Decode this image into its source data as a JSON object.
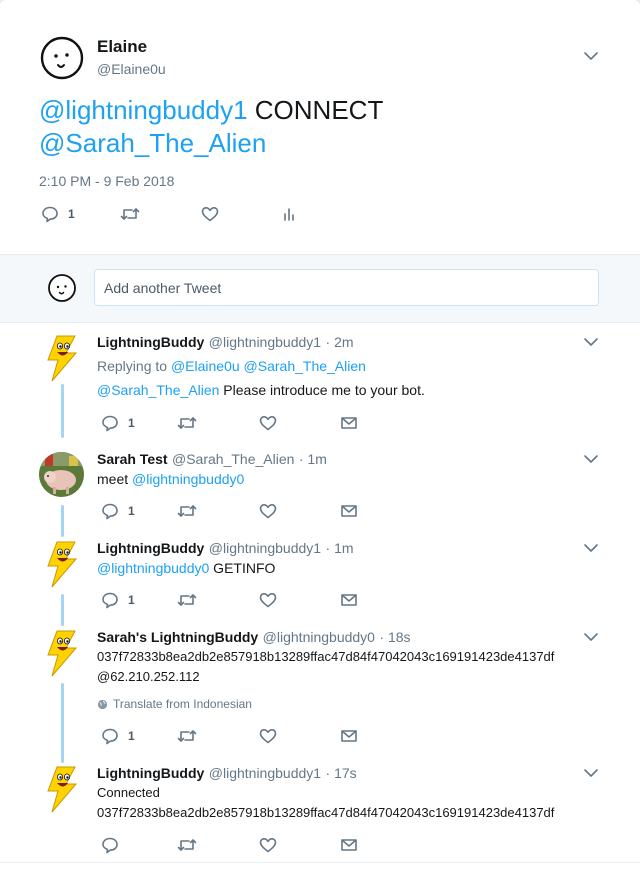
{
  "main_tweet": {
    "name": "Elaine",
    "handle": "@Elaine0u",
    "mention1": "@lightningbuddy1",
    "command": " CONNECT",
    "mention2": "@Sarah_The_Alien",
    "timestamp": "2:10 PM - 9 Feb 2018",
    "reply_count": "1"
  },
  "compose": {
    "placeholder": "Add another Tweet"
  },
  "replies": [
    {
      "name": "LightningBuddy",
      "handle": "@lightningbuddy1",
      "age": "· 2m",
      "replying_label": "Replying to ",
      "replying_to1": "@Elaine0u",
      "replying_to2": "@Sarah_The_Alien",
      "mention": "@Sarah_The_Alien",
      "text": " Please introduce me to your bot.",
      "reply_count": "1"
    },
    {
      "name": "Sarah Test",
      "handle": "@Sarah_The_Alien",
      "age": "· 1m",
      "prefix": "meet ",
      "mention": "@lightningbuddy0",
      "reply_count": "1"
    },
    {
      "name": "LightningBuddy",
      "handle": "@lightningbuddy1",
      "age": "· 1m",
      "mention": "@lightningbuddy0",
      "text": " GETINFO",
      "reply_count": "1"
    },
    {
      "name": "Sarah's LightningBuddy",
      "handle": "@lightningbuddy0",
      "age": "· 18s",
      "line1": "037f72833b8ea2db2e857918b13289ffac47d84f47042043c169191423de4137df",
      "line2": "@62.210.252.112",
      "translate": "Translate from Indonesian",
      "reply_count": "1"
    },
    {
      "name": "LightningBuddy",
      "handle": "@lightningbuddy1",
      "age": "· 17s",
      "line1": "Connected",
      "line2": "037f72833b8ea2db2e857918b13289ffac47d84f47042043c169191423de4137df"
    }
  ],
  "colors": {
    "accent": "#1da1f2",
    "muted": "#657786",
    "thread_line": "#a6d4f5",
    "background": "#e6ecf0"
  },
  "icons": [
    "smiley-avatar-icon",
    "lightning-avatar-icon",
    "pig-photo-avatar",
    "chevron-down-icon",
    "reply-icon",
    "retweet-icon",
    "like-icon",
    "analytics-icon",
    "message-icon",
    "globe-icon"
  ]
}
